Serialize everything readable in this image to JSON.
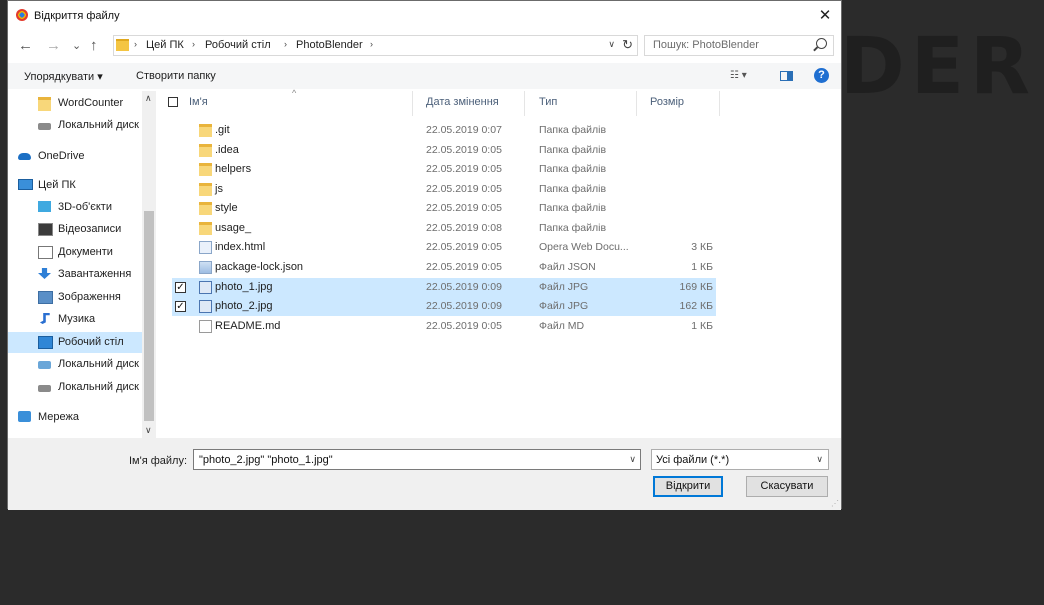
{
  "background_text": "DER",
  "dialog": {
    "title": "Відкриття файлу",
    "close": "✕"
  },
  "nav": {
    "back": "←",
    "forward": "→",
    "recent": "⌄",
    "up": "↑"
  },
  "address": {
    "crumbs": [
      "Цей ПК",
      "Робочий стіл",
      "PhotoBlender"
    ],
    "separator": "›"
  },
  "search": {
    "placeholder": "Пошук: PhotoBlender"
  },
  "commands": {
    "organize": "Упорядкувати ▾",
    "new_folder": "Створити папку"
  },
  "sidebar": {
    "items": [
      {
        "label": "WordCounter",
        "icon": "folder-icon",
        "indent": 2
      },
      {
        "label": "Локальний диск",
        "icon": "drive-icon",
        "indent": 2
      },
      {
        "label": "OneDrive",
        "icon": "onedrive-icon",
        "indent": 1
      },
      {
        "label": "Цей ПК",
        "icon": "pc-icon",
        "indent": 1
      },
      {
        "label": "3D-об'єкти",
        "icon": "3d-objects-icon",
        "indent": 2
      },
      {
        "label": "Відеозаписи",
        "icon": "video-icon",
        "indent": 2
      },
      {
        "label": "Документи",
        "icon": "documents-icon",
        "indent": 2
      },
      {
        "label": "Завантаження",
        "icon": "download-icon",
        "indent": 2
      },
      {
        "label": "Зображення",
        "icon": "pictures-icon",
        "indent": 2
      },
      {
        "label": "Музика",
        "icon": "music-icon",
        "indent": 2
      },
      {
        "label": "Робочий стіл",
        "icon": "desktop-icon",
        "indent": 2,
        "active": true
      },
      {
        "label": "Локальний диск",
        "icon": "system-drive-icon",
        "indent": 2
      },
      {
        "label": "Локальний диск",
        "icon": "drive-icon",
        "indent": 2
      },
      {
        "label": "Мережа",
        "icon": "network-icon",
        "indent": 1
      }
    ]
  },
  "columns": {
    "name": "Ім'я",
    "date": "Дата змінення",
    "type": "Тип",
    "size": "Розмір"
  },
  "files": [
    {
      "name": ".git",
      "date": "22.05.2019 0:07",
      "type": "Папка файлів",
      "size": "",
      "kind": "folder"
    },
    {
      "name": ".idea",
      "date": "22.05.2019 0:05",
      "type": "Папка файлів",
      "size": "",
      "kind": "folder"
    },
    {
      "name": "helpers",
      "date": "22.05.2019 0:05",
      "type": "Папка файлів",
      "size": "",
      "kind": "folder"
    },
    {
      "name": "js",
      "date": "22.05.2019 0:05",
      "type": "Папка файлів",
      "size": "",
      "kind": "folder"
    },
    {
      "name": "style",
      "date": "22.05.2019 0:05",
      "type": "Папка файлів",
      "size": "",
      "kind": "folder"
    },
    {
      "name": "usage_",
      "date": "22.05.2019 0:08",
      "type": "Папка файлів",
      "size": "",
      "kind": "folder"
    },
    {
      "name": "index.html",
      "date": "22.05.2019 0:05",
      "type": "Opera Web Docu...",
      "size": "3 КБ",
      "kind": "html"
    },
    {
      "name": "package-lock.json",
      "date": "22.05.2019 0:05",
      "type": "Файл JSON",
      "size": "1 КБ",
      "kind": "json"
    },
    {
      "name": "photo_1.jpg",
      "date": "22.05.2019 0:09",
      "type": "Файл JPG",
      "size": "169 КБ",
      "kind": "jpg",
      "selected": true
    },
    {
      "name": "photo_2.jpg",
      "date": "22.05.2019 0:09",
      "type": "Файл JPG",
      "size": "162 КБ",
      "kind": "jpg",
      "selected": true
    },
    {
      "name": "README.md",
      "date": "22.05.2019 0:05",
      "type": "Файл MD",
      "size": "1 КБ",
      "kind": "md"
    }
  ],
  "filename": {
    "label": "Ім'я файлу:",
    "value": "\"photo_2.jpg\" \"photo_1.jpg\""
  },
  "filter": {
    "value": "Усі файли (*.*)"
  },
  "buttons": {
    "open": "Відкрити",
    "cancel": "Скасувати"
  },
  "colors": {
    "selection": "#cce8ff",
    "accent": "#0078d7",
    "folder": "#f8d77a"
  }
}
